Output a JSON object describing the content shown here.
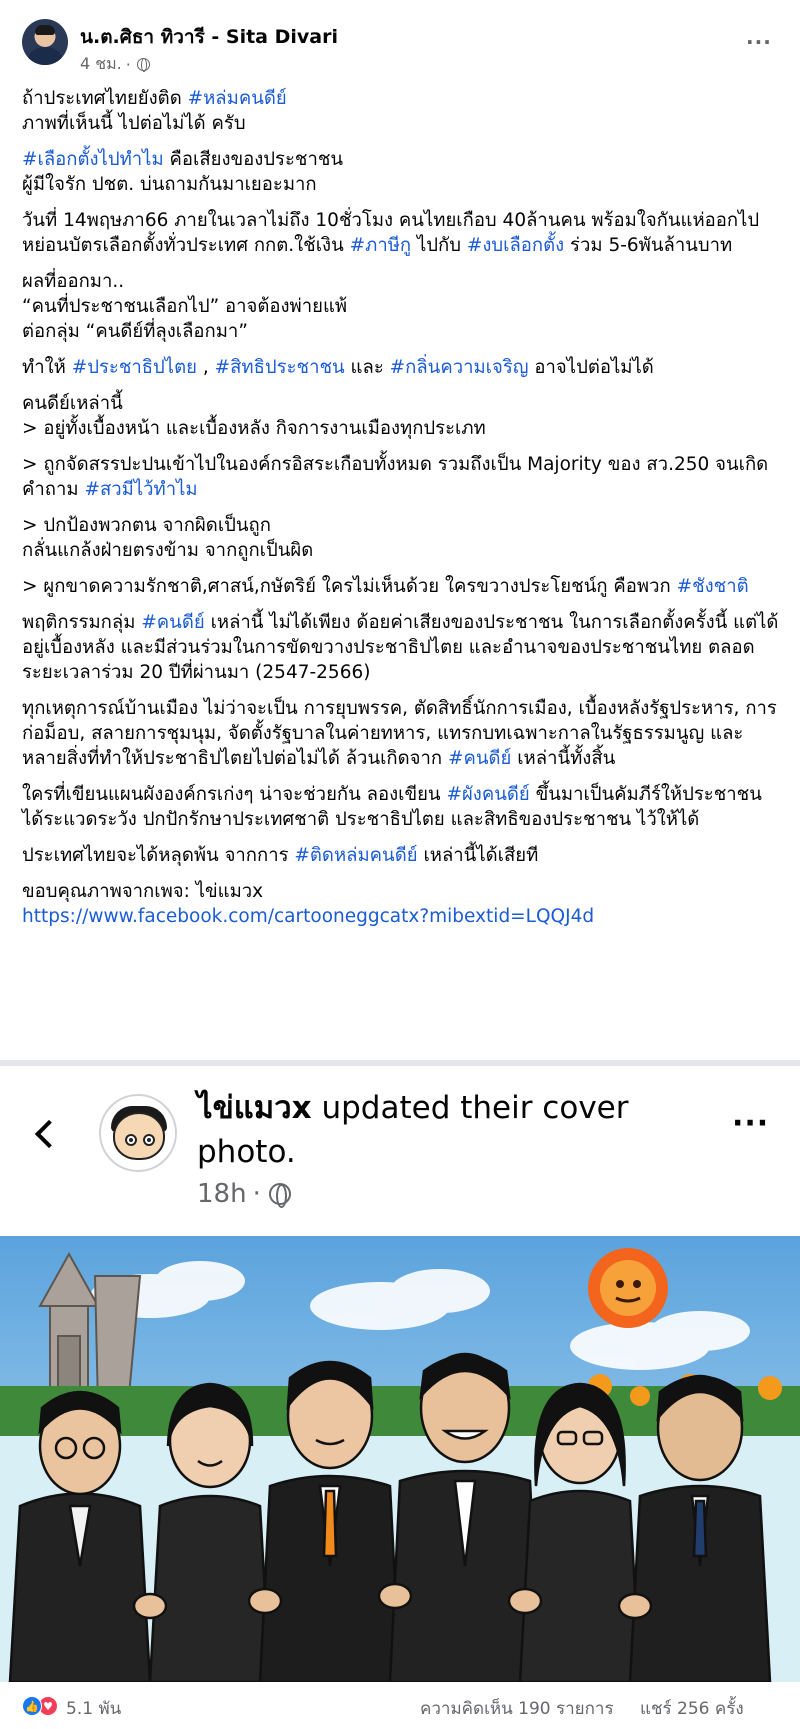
{
  "post": {
    "author": "น.ต.ศิธา ทิวารี - Sita Divari",
    "time": "4 ชม.",
    "dot": "·",
    "more": "···"
  },
  "body": {
    "p1_a": "ถ้าประเทศไทยยังติด ",
    "p1_tag": "#หล่มคนดีย์",
    "p1_b": "ภาพที่เห็นนี้ ไปต่อไม่ได้ ครับ",
    "p2_tag": "#เลือกตั้งไปทำไม",
    "p2_a": " คือเสียงของประชาชน",
    "p2_b": "ผู้มีใจรัก ปชต. บ่นถามกันมาเยอะมาก",
    "p3_a": "วันที่ 14พฤษภา66 ภายในเวลาไม่ถึง 10ชั่วโมง คนไทยเกือบ 40ล้านคน พร้อมใจกันแห่ออกไปหย่อนบัตรเลือกตั้งทั่วประเทศ กกต.ใช้เงิน ",
    "p3_tag1": "#ภาษีกู",
    "p3_b": " ไปกับ ",
    "p3_tag2": "#งบเลือกตั้ง",
    "p3_c": " ร่วม 5-6พันล้านบาท",
    "p4_a": "ผลที่ออกมา..",
    "p4_b": "“คนที่ประชาชนเลือกไป” อาจต้องพ่ายแพ้",
    "p4_c": "ต่อกลุ่ม “คนดีย์ที่ลุงเลือกมา”",
    "p5_a": "ทำให้ ",
    "p5_tag1": "#ประชาธิปไตย",
    "p5_b": " , ",
    "p5_tag2": "#สิทธิประชาชน",
    "p5_c": " และ ",
    "p5_tag3": "#กลิ่นความเจริญ",
    "p5_d": " อาจไปต่อไม่ได้",
    "p6_a": "คนดีย์เหล่านี้",
    "p6_b": "> อยู่ทั้งเบื้องหน้า และเบื้องหลัง กิจการงานเมืองทุกประเภท",
    "p7_a": "> ถูกจัดสรรปะปนเข้าไปในองค์กรอิสระเกือบทั้งหมด รวมถึงเป็น Majority ของ สว.250 จนเกิดคำถาม ",
    "p7_tag": "#สวมีไว้ทำไม",
    "p8_a": "> ปกป้องพวกตน จากผิดเป็นถูก",
    "p8_b": "กลั่นแกล้งฝ่ายตรงข้าม จากถูกเป็นผิด",
    "p9_a": "> ผูกขาดความรักชาติ,ศาสน์,กษัตริย์ ใครไม่เห็นด้วย ใครขวางประโยชน์กู คือพวก ",
    "p9_tag": "#ชังชาติ",
    "p10_a": "พฤติกรรมกลุ่ม ",
    "p10_tag": "#คนดีย์",
    "p10_b": " เหล่านี้ ไม่ได้เพียง ด้อยค่าเสียงของประชาชน ในการเลือกตั้งครั้งนี้ แต่ได้อยู่เบื้องหลัง และมีส่วนร่วมในการขัดขวางประชาธิปไตย และอำนาจของประชาชนไทย ตลอดระยะเวลาร่วม 20 ปีที่ผ่านมา (2547-2566)",
    "p11_a": "ทุกเหตุการณ์บ้านเมือง ไม่ว่าจะเป็น การยุบพรรค, ตัดสิทธิ์นักการเมือง, เบื้องหลังรัฐประหาร, การก่อม็อบ, สลายการชุมนุม, จัดตั้งรัฐบาลในค่ายทหาร, แทรกบทเฉพาะกาลในรัฐธรรมนูญ และหลายสิ่งที่ทำให้ประชาธิปไตยไปต่อไม่ได้ ล้วนเกิดจาก ",
    "p11_tag": "#คนดีย์",
    "p11_b": " เหล่านี้ทั้งสิ้น",
    "p12_a": "ใครที่เขียนแผนผังองค์กรเก่งๆ น่าจะช่วยกัน ลองเขียน ",
    "p12_tag": "#ผังคนดีย์",
    "p12_b": " ขึ้นมาเป็นคัมภีร์ให้ประชาชน ได้ระแวดระวัง ปกปักรักษาประเทศชาติ ประชาธิปไตย และสิทธิของประชาชน ไว้ให้ได้",
    "p13_a": "ประเทศไทยจะได้หลุดพ้น จากการ ",
    "p13_tag": "#ติดหล่มคนดีย์",
    "p13_b": "  เหล่านี้ได้เสียที",
    "p14_a": "ขอบคุณภาพจากเพจ:  ไข่แมวx",
    "p14_link": "https://www.facebook.com/cartooneggcatx?mibextid=LQQJ4d"
  },
  "shared": {
    "page_name": "ไข่แมวx",
    "action": " updated their cover photo.",
    "time": "18h",
    "dot": "·",
    "more": "···"
  },
  "footer": {
    "reactions": "5.1 พัน",
    "comments": "ความคิดเห็น 190 รายการ",
    "shares": "แชร์ 256 ครั้ง"
  },
  "icons": {
    "globe": "globe-icon",
    "back": "chevron-left-icon",
    "like": "like-icon",
    "love": "love-icon"
  },
  "colors": {
    "hashtag": "#1a5bd6",
    "meta": "#65676b",
    "like": "#1877f2",
    "love": "#f33e58"
  }
}
